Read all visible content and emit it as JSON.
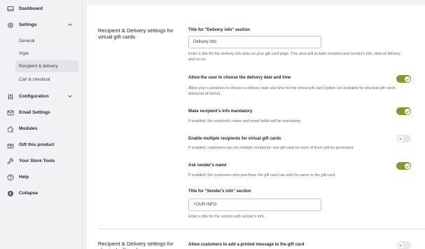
{
  "sidebar": {
    "items": [
      {
        "label": "Dashboard"
      },
      {
        "label": "Settings"
      },
      {
        "label": "Configuration"
      },
      {
        "label": "Email Settings"
      },
      {
        "label": "Modules"
      },
      {
        "label": "Gift this product"
      },
      {
        "label": "Your Store Tools"
      },
      {
        "label": "Help"
      },
      {
        "label": "Collapse"
      }
    ],
    "settings_sub": [
      {
        "label": "General"
      },
      {
        "label": "Style"
      },
      {
        "label": "Recipient & delivery"
      },
      {
        "label": "Cart & checkout"
      }
    ],
    "active_sub": "Recipient & delivery"
  },
  "main": {
    "section_title": "Recipient & Delivery settings for virtual gift cards",
    "section2_title": "Recipient & Delivery settings for physical gift cards",
    "delivery_info_title": {
      "label": "Title for \"Delivery info\" section",
      "value": "Delivery info",
      "description": "Enter a title for the delivery info area on your gift card page. This area will include recipient and sender's info, date of delivery and so on."
    },
    "allow_delivery_date": {
      "label": "Allow the user to choose the delivery date and time",
      "description": "Allow your customers to choose a delivery date and time for the virtual gift card (option not available for physical gift cards delivered at home).",
      "enabled": true
    },
    "recipient_mandatory": {
      "label": "Make recipient's info mandatory",
      "description": "If enabled, the recipient's name and email fields will be mandatory.",
      "enabled": true
    },
    "multiple_recipients": {
      "label": "Enable multiple recipients for virtual gift cards",
      "description": "If enabled, customers can set multiple recipients: one gift card for each of them will be generated.",
      "enabled": false
    },
    "ask_sender_name": {
      "label": "Ask sender's name",
      "description": "If enabled, the customers who purchase the gift card can add his name to the gift card.",
      "enabled": true
    },
    "sender_info_title": {
      "label": "Title for \"Sender's info\" section",
      "value": "YOUR INFO",
      "description": "Enter a title for the section with sender's info."
    },
    "printed_message": {
      "label": "Allow customers to add a printed message to the gift card",
      "enabled": false
    }
  },
  "colors": {
    "toggle_on": "#7f9c2d",
    "toggle_off": "#e5e7eb",
    "background": "#f1f2f4"
  }
}
